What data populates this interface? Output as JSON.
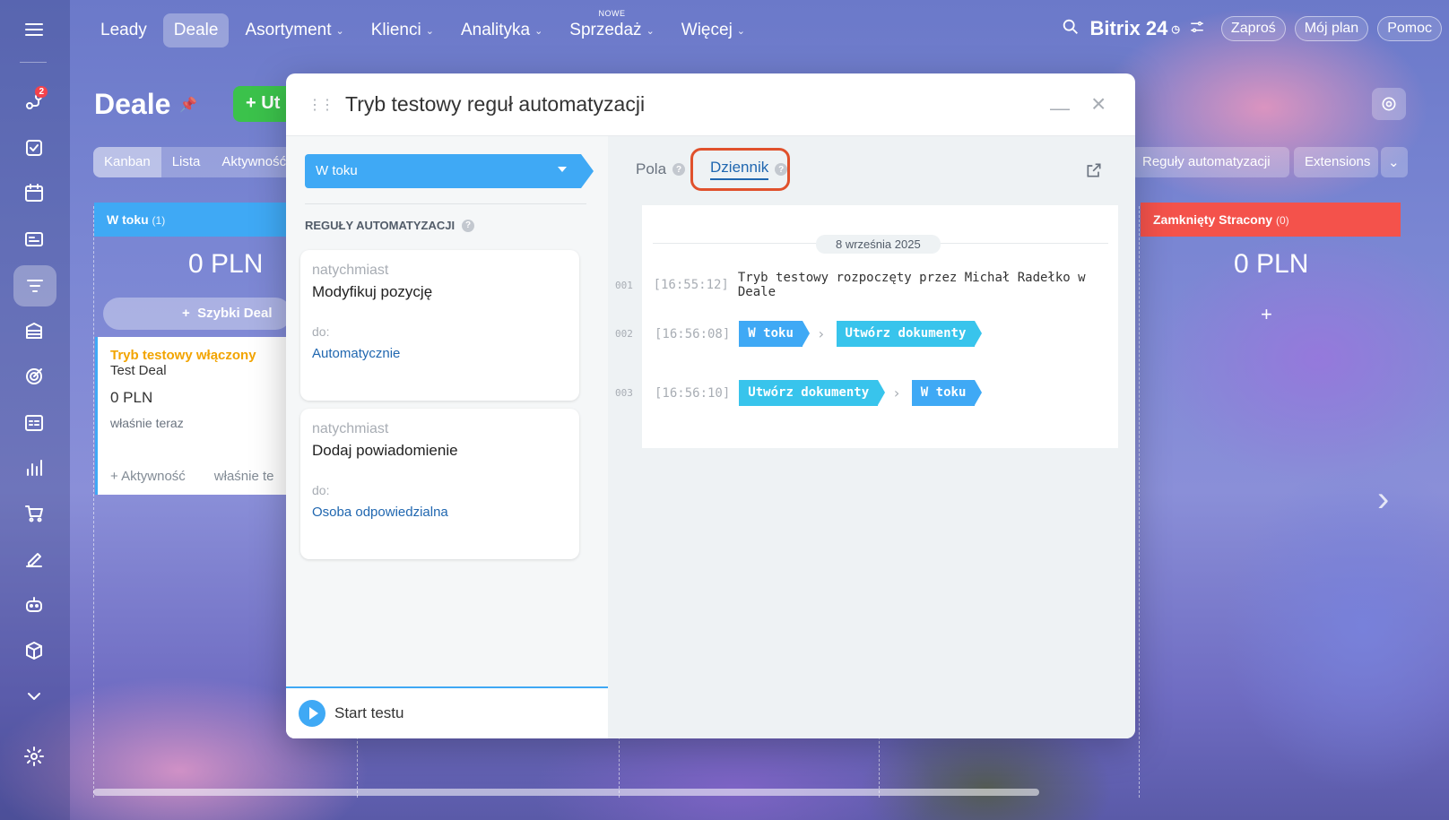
{
  "sidebar": {
    "items": [
      {
        "icon": "menu-icon",
        "badge": ""
      },
      {
        "icon": "chats-icon",
        "badge": "2"
      },
      {
        "icon": "tasks-icon",
        "badge": ""
      },
      {
        "icon": "calendar-icon",
        "badge": ""
      },
      {
        "icon": "feed-icon",
        "badge": ""
      },
      {
        "icon": "crm-funnel-icon",
        "badge": ""
      },
      {
        "icon": "company-icon",
        "badge": ""
      },
      {
        "icon": "target-icon",
        "badge": ""
      },
      {
        "icon": "planner-icon",
        "badge": ""
      },
      {
        "icon": "analytics-icon",
        "badge": ""
      },
      {
        "icon": "cart-icon",
        "badge": ""
      },
      {
        "icon": "sign-icon",
        "badge": ""
      },
      {
        "icon": "robot-icon",
        "badge": ""
      },
      {
        "icon": "box-icon",
        "badge": ""
      },
      {
        "icon": "more-chevron-icon",
        "badge": ""
      },
      {
        "icon": "settings-icon",
        "badge": ""
      }
    ]
  },
  "topnav": {
    "items": [
      {
        "label": "Leady",
        "dropdown": false,
        "sup": ""
      },
      {
        "label": "Deale",
        "dropdown": false,
        "sup": "",
        "active": true
      },
      {
        "label": "Asortyment",
        "dropdown": true,
        "sup": ""
      },
      {
        "label": "Klienci",
        "dropdown": true,
        "sup": ""
      },
      {
        "label": "Analityka",
        "dropdown": true,
        "sup": ""
      },
      {
        "label": "Sprzedaż",
        "dropdown": true,
        "sup": "NOWE"
      },
      {
        "label": "Więcej",
        "dropdown": true,
        "sup": ""
      }
    ],
    "brand": "Bitrix 24",
    "invite": "Zaproś",
    "plan": "Mój plan",
    "help": "Pomoc"
  },
  "page": {
    "title": "Deale",
    "create_label": "Ut",
    "view_tabs": [
      "Kanban",
      "Lista",
      "Aktywność"
    ],
    "rules_button": "Reguły automatyzacji",
    "extensions_button": "Extensions",
    "columns": [
      {
        "name": "W toku",
        "count": "(1)",
        "sum": "0 PLN",
        "color": "#3fa9f5"
      },
      {
        "name": "Zamknięty Stracony",
        "count": "(0)",
        "sum": "0 PLN",
        "color": "#f4524b"
      }
    ],
    "quick_deal": "Szybki Deal",
    "card": {
      "badge": "Tryb testowy włączony",
      "title_rest": " Test Deal",
      "sum": "0 PLN",
      "time": "właśnie teraz",
      "activity": "+ Aktywność",
      "time2": "właśnie te"
    }
  },
  "modal": {
    "title": "Tryb testowy reguł automatyzacji",
    "stage": "W toku",
    "rules_heading": "REGUŁY AUTOMATYZACJI",
    "rules": [
      {
        "when": "natychmiast",
        "name": "Modyfikuj pozycję",
        "to_label": "do:",
        "target": "Automatycznie"
      },
      {
        "when": "natychmiast",
        "name": "Dodaj powiadomienie",
        "to_label": "do:",
        "target": "Osoba odpowiedzialna"
      }
    ],
    "start": "Start testu",
    "tabs": [
      {
        "label": "Pola"
      },
      {
        "label": "Dziennik",
        "active": true
      }
    ],
    "log": {
      "date": "8 września 2025",
      "entries": [
        {
          "num": "001",
          "time": "[16:55:12]",
          "text": "Tryb testowy rozpoczęty przez Michał Radełko w Deale"
        },
        {
          "num": "002",
          "time": "[16:56:08]",
          "from": "W toku",
          "to": "Utwórz dokumenty"
        },
        {
          "num": "003",
          "time": "[16:56:10]",
          "from": "Utwórz dokumenty",
          "to": "W toku"
        }
      ]
    }
  },
  "colors": {
    "accent": "#3fa9f5",
    "highlight": "#e0512c",
    "create": "#3bc24b",
    "lost": "#f4524b"
  }
}
